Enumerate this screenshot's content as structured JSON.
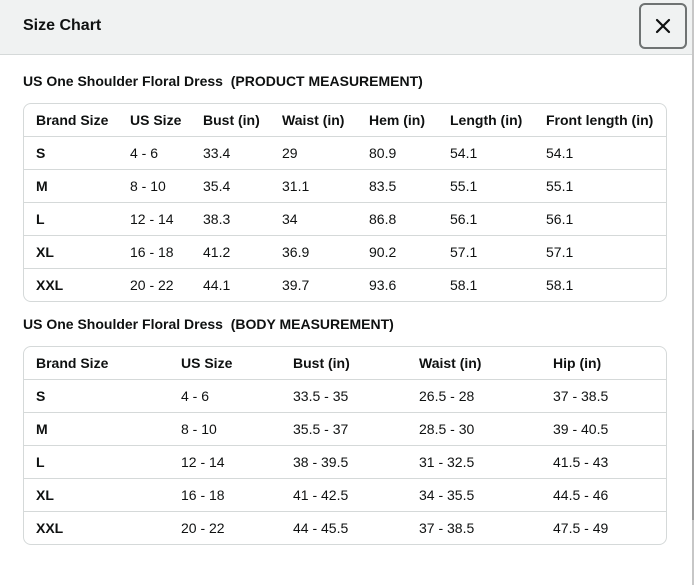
{
  "dialog": {
    "title": "Size Chart",
    "close_icon": "close-icon"
  },
  "product_section": {
    "title": "US One Shoulder Floral Dress  (PRODUCT MEASUREMENT)",
    "columns": [
      "Brand Size",
      "US Size",
      "Bust (in)",
      "Waist (in)",
      "Hem (in)",
      "Length (in)",
      "Front length (in)"
    ],
    "rows": [
      [
        "S",
        "4 - 6",
        "33.4",
        "29",
        "80.9",
        "54.1",
        "54.1"
      ],
      [
        "M",
        "8 - 10",
        "35.4",
        "31.1",
        "83.5",
        "55.1",
        "55.1"
      ],
      [
        "L",
        "12 - 14",
        "38.3",
        "34",
        "86.8",
        "56.1",
        "56.1"
      ],
      [
        "XL",
        "16 - 18",
        "41.2",
        "36.9",
        "90.2",
        "57.1",
        "57.1"
      ],
      [
        "XXL",
        "20 - 22",
        "44.1",
        "39.7",
        "93.6",
        "58.1",
        "58.1"
      ]
    ]
  },
  "body_section": {
    "title": "US One Shoulder Floral Dress  (BODY MEASUREMENT)",
    "columns": [
      "Brand Size",
      "US Size",
      "Bust (in)",
      "Waist (in)",
      "Hip (in)"
    ],
    "rows": [
      [
        "S",
        "4 - 6",
        "33.5 - 35",
        "26.5 - 28",
        "37 - 38.5"
      ],
      [
        "M",
        "8 - 10",
        "35.5 - 37",
        "28.5 - 30",
        "39 - 40.5"
      ],
      [
        "L",
        "12 - 14",
        "38 - 39.5",
        "31 - 32.5",
        "41.5 - 43"
      ],
      [
        "XL",
        "16 - 18",
        "41 - 42.5",
        "34 - 35.5",
        "44.5 - 46"
      ],
      [
        "XXL",
        "20 - 22",
        "44 - 45.5",
        "37 - 38.5",
        "47.5 - 49"
      ]
    ]
  }
}
